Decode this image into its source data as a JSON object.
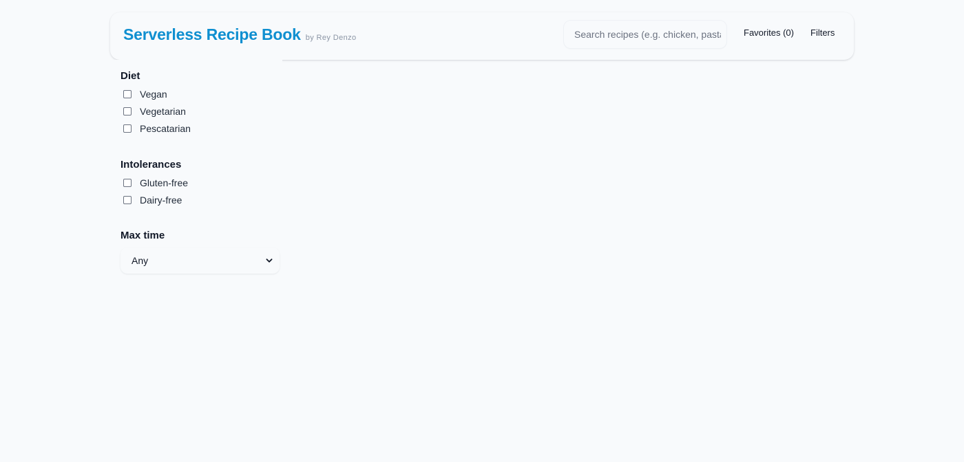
{
  "header": {
    "title": "Serverless Recipe Book",
    "byline": "by Rey Denzo",
    "search": {
      "placeholder": "Search recipes (e.g. chicken, pasta)",
      "value": ""
    },
    "favorites_label": "Favorites (0)",
    "filters_label": "Filters"
  },
  "filters": {
    "diet": {
      "title": "Diet",
      "options": [
        {
          "label": "Vegan",
          "checked": false
        },
        {
          "label": "Vegetarian",
          "checked": false
        },
        {
          "label": "Pescatarian",
          "checked": false
        }
      ]
    },
    "intolerances": {
      "title": "Intolerances",
      "options": [
        {
          "label": "Gluten-free",
          "checked": false
        },
        {
          "label": "Dairy-free",
          "checked": false
        }
      ]
    },
    "max_time": {
      "title": "Max time",
      "selected": "Any"
    }
  },
  "colors": {
    "brand": "#0f8fd0",
    "background": "#f8fafc",
    "text": "#111827",
    "muted": "#8b95a5"
  }
}
